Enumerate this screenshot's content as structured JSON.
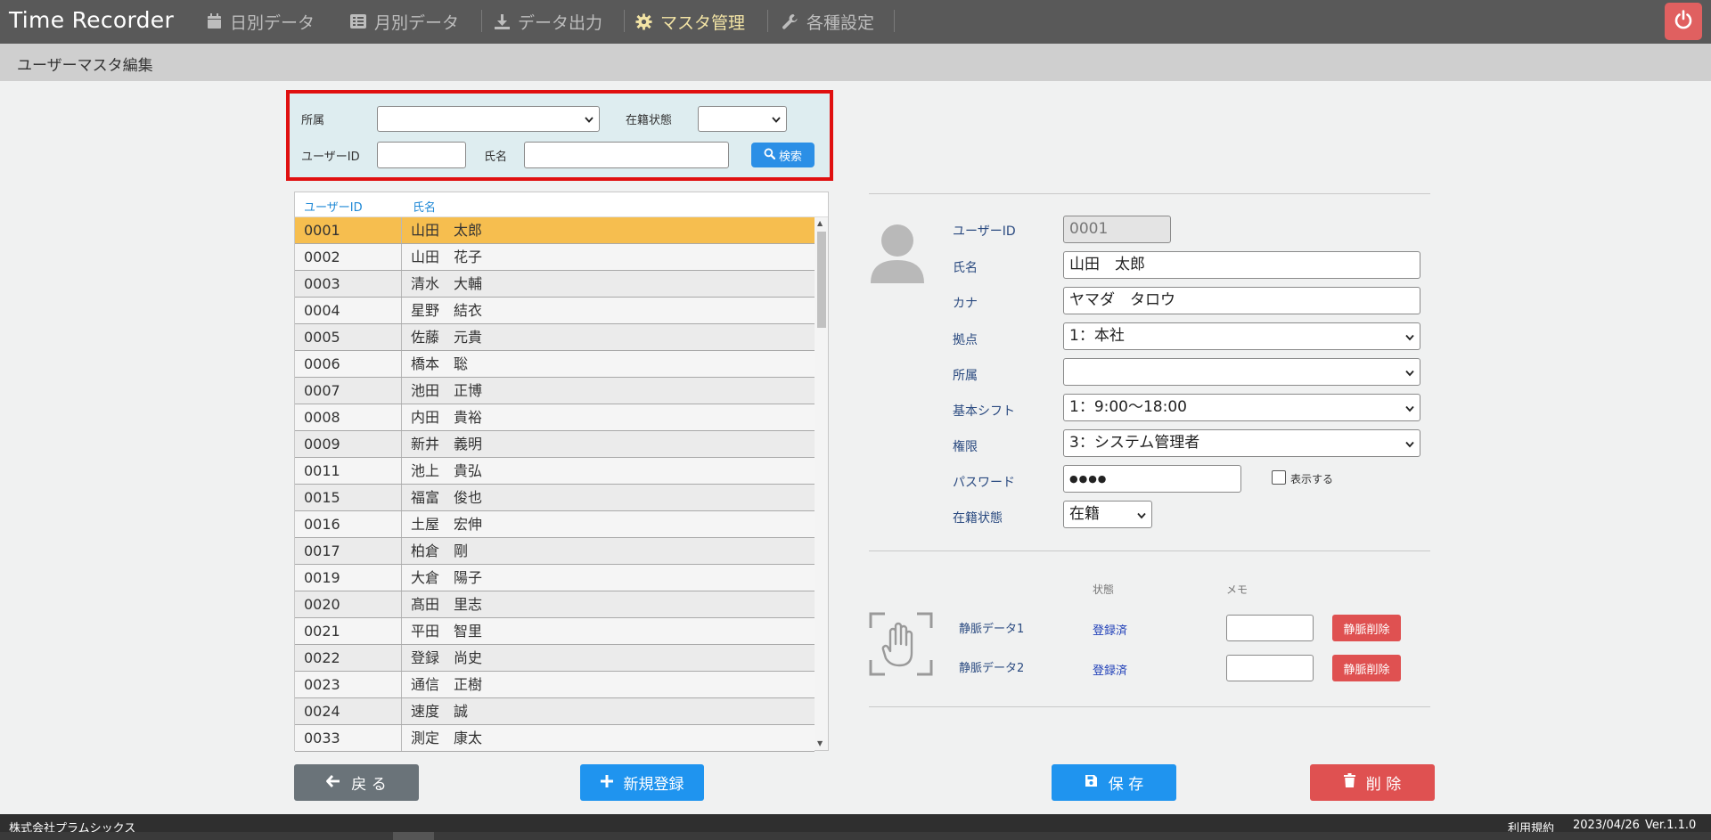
{
  "header": {
    "brand": "Time Recorder",
    "nav": [
      {
        "label": "日別データ",
        "icon": "calendar-icon"
      },
      {
        "label": "月別データ",
        "icon": "list-icon"
      },
      {
        "label": "データ出力",
        "icon": "download-icon"
      },
      {
        "label": "マスタ管理",
        "icon": "gear-icon",
        "active": true
      },
      {
        "label": "各種設定",
        "icon": "wrench-icon"
      }
    ],
    "power_icon": "power-icon"
  },
  "page_title": "ユーザーマスタ編集",
  "search": {
    "dept_label": "所属",
    "dept_value": "",
    "status_label": "在籍状態",
    "status_value": "",
    "userid_label": "ユーザーID",
    "userid_value": "",
    "name_label": "氏名",
    "name_value": "",
    "button_label": "検索"
  },
  "list": {
    "col_id": "ユーザーID",
    "col_name": "氏名",
    "rows": [
      {
        "id": "0001",
        "name": "山田　太郎"
      },
      {
        "id": "0002",
        "name": "山田　花子"
      },
      {
        "id": "0003",
        "name": "清水　大輔"
      },
      {
        "id": "0004",
        "name": "星野　結衣"
      },
      {
        "id": "0005",
        "name": "佐藤　元貴"
      },
      {
        "id": "0006",
        "name": "橋本　聡"
      },
      {
        "id": "0007",
        "name": "池田　正博"
      },
      {
        "id": "0008",
        "name": "内田　貴裕"
      },
      {
        "id": "0009",
        "name": "新井　義明"
      },
      {
        "id": "0011",
        "name": "池上　貴弘"
      },
      {
        "id": "0015",
        "name": "福富　俊也"
      },
      {
        "id": "0016",
        "name": "土屋　宏伸"
      },
      {
        "id": "0017",
        "name": "柏倉　剛"
      },
      {
        "id": "0019",
        "name": "大倉　陽子"
      },
      {
        "id": "0020",
        "name": "髙田　里志"
      },
      {
        "id": "0021",
        "name": "平田　智里"
      },
      {
        "id": "0022",
        "name": "登録　尚史"
      },
      {
        "id": "0023",
        "name": "通信　正樹"
      },
      {
        "id": "0024",
        "name": "速度　誠"
      },
      {
        "id": "0033",
        "name": "測定　康太"
      }
    ],
    "selected_index": 0
  },
  "detail": {
    "userid_label": "ユーザーID",
    "userid_value": "0001",
    "name_label": "氏名",
    "name_value": "山田　太郎",
    "kana_label": "カナ",
    "kana_value": "ヤマダ　タロウ",
    "base_label": "拠点",
    "base_value": "1：本社",
    "dept_label": "所属",
    "dept_value": "",
    "shift_label": "基本シフト",
    "shift_value": "1：9:00～18:00",
    "role_label": "権限",
    "role_value": "3：システム管理者",
    "password_label": "パスワード",
    "password_value": "●●●●",
    "show_password_label": "表示する",
    "status_label": "在籍状態",
    "status_value": "在籍"
  },
  "vein": {
    "col_state": "状態",
    "col_memo": "メモ",
    "items": [
      {
        "label": "静脈データ1",
        "state": "登録済",
        "memo": "",
        "delete_label": "静脈削除"
      },
      {
        "label": "静脈データ2",
        "state": "登録済",
        "memo": "",
        "delete_label": "静脈削除"
      }
    ]
  },
  "buttons": {
    "back": "戻 る",
    "new": "新規登録",
    "save": "保 存",
    "delete": "削 除"
  },
  "footer": {
    "company": "株式会社プラムシックス",
    "terms": "利用規約",
    "date": "2023/04/26",
    "version": "Ver.1.1.0"
  },
  "colors": {
    "nav_bg": "#595959",
    "search_border": "#e01010",
    "selected_row": "#f6be4f",
    "primary": "#1f94ef",
    "danger": "#df5151"
  }
}
